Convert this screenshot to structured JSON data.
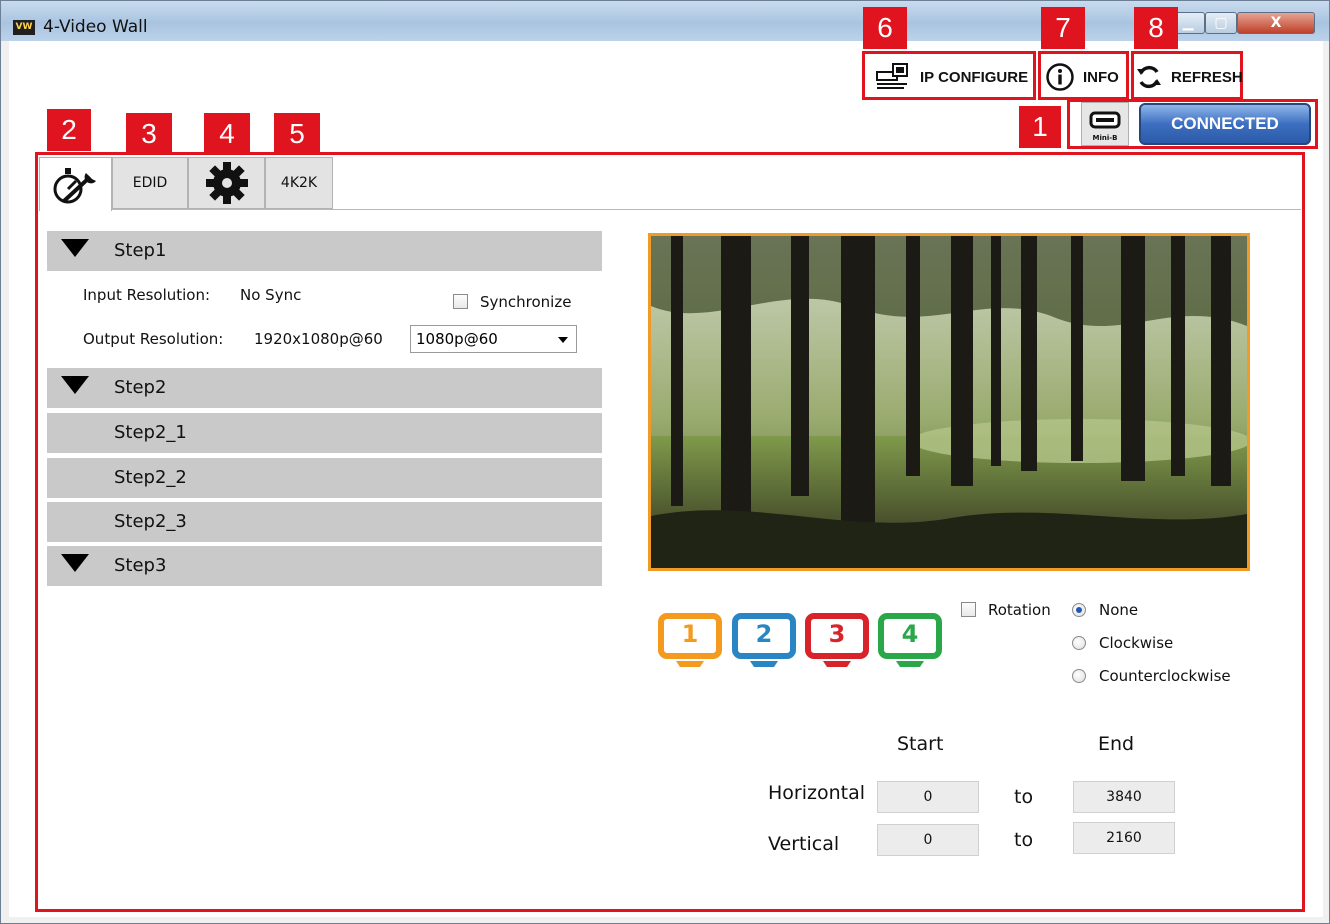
{
  "window": {
    "title": "4-Video Wall",
    "app_icon_text": "VW"
  },
  "toolbar": {
    "ip_configure_label": "IP CONFIGURE",
    "info_label": "INFO",
    "refresh_label": "REFRESH",
    "usb_icon_caption": "Mini-B",
    "connection_label": "CONNECTED"
  },
  "callouts": [
    "1",
    "2",
    "3",
    "4",
    "5",
    "6",
    "7",
    "8"
  ],
  "tabs": [
    {
      "label": "",
      "icon": "wrench-dial-icon"
    },
    {
      "label": "EDID",
      "icon": ""
    },
    {
      "label": "",
      "icon": "gear-icon"
    },
    {
      "label": "4K2K",
      "icon": ""
    }
  ],
  "steps": {
    "step1": "Step1",
    "input_resolution_label": "Input Resolution:",
    "input_resolution_value": "No Sync",
    "synchronize_label": "Synchronize",
    "synchronize_checked": false,
    "output_resolution_label": "Output Resolution:",
    "output_resolution_value": "1920x1080p@60",
    "output_select_value": "1080p@60",
    "step2": "Step2",
    "step2_1": "Step2_1",
    "step2_2": "Step2_2",
    "step2_3": "Step2_3",
    "step3": "Step3"
  },
  "monitors": [
    {
      "num": "1",
      "color": "#f39a1f"
    },
    {
      "num": "2",
      "color": "#2a85c5"
    },
    {
      "num": "3",
      "color": "#d8232a"
    },
    {
      "num": "4",
      "color": "#2aa748"
    }
  ],
  "rotation": {
    "label": "Rotation",
    "checked": false,
    "options": [
      "None",
      "Clockwise",
      "Counterclockwise"
    ],
    "selected": "None"
  },
  "range": {
    "start_header": "Start",
    "end_header": "End",
    "horizontal_label": "Horizontal",
    "vertical_label": "Vertical",
    "to_label": "to",
    "h_start": "0",
    "h_end": "3840",
    "v_start": "0",
    "v_end": "2160"
  },
  "colors": {
    "callout_red": "#e0141e",
    "preview_border": "#f09a28",
    "connected_blue": "#3d6fc0"
  }
}
